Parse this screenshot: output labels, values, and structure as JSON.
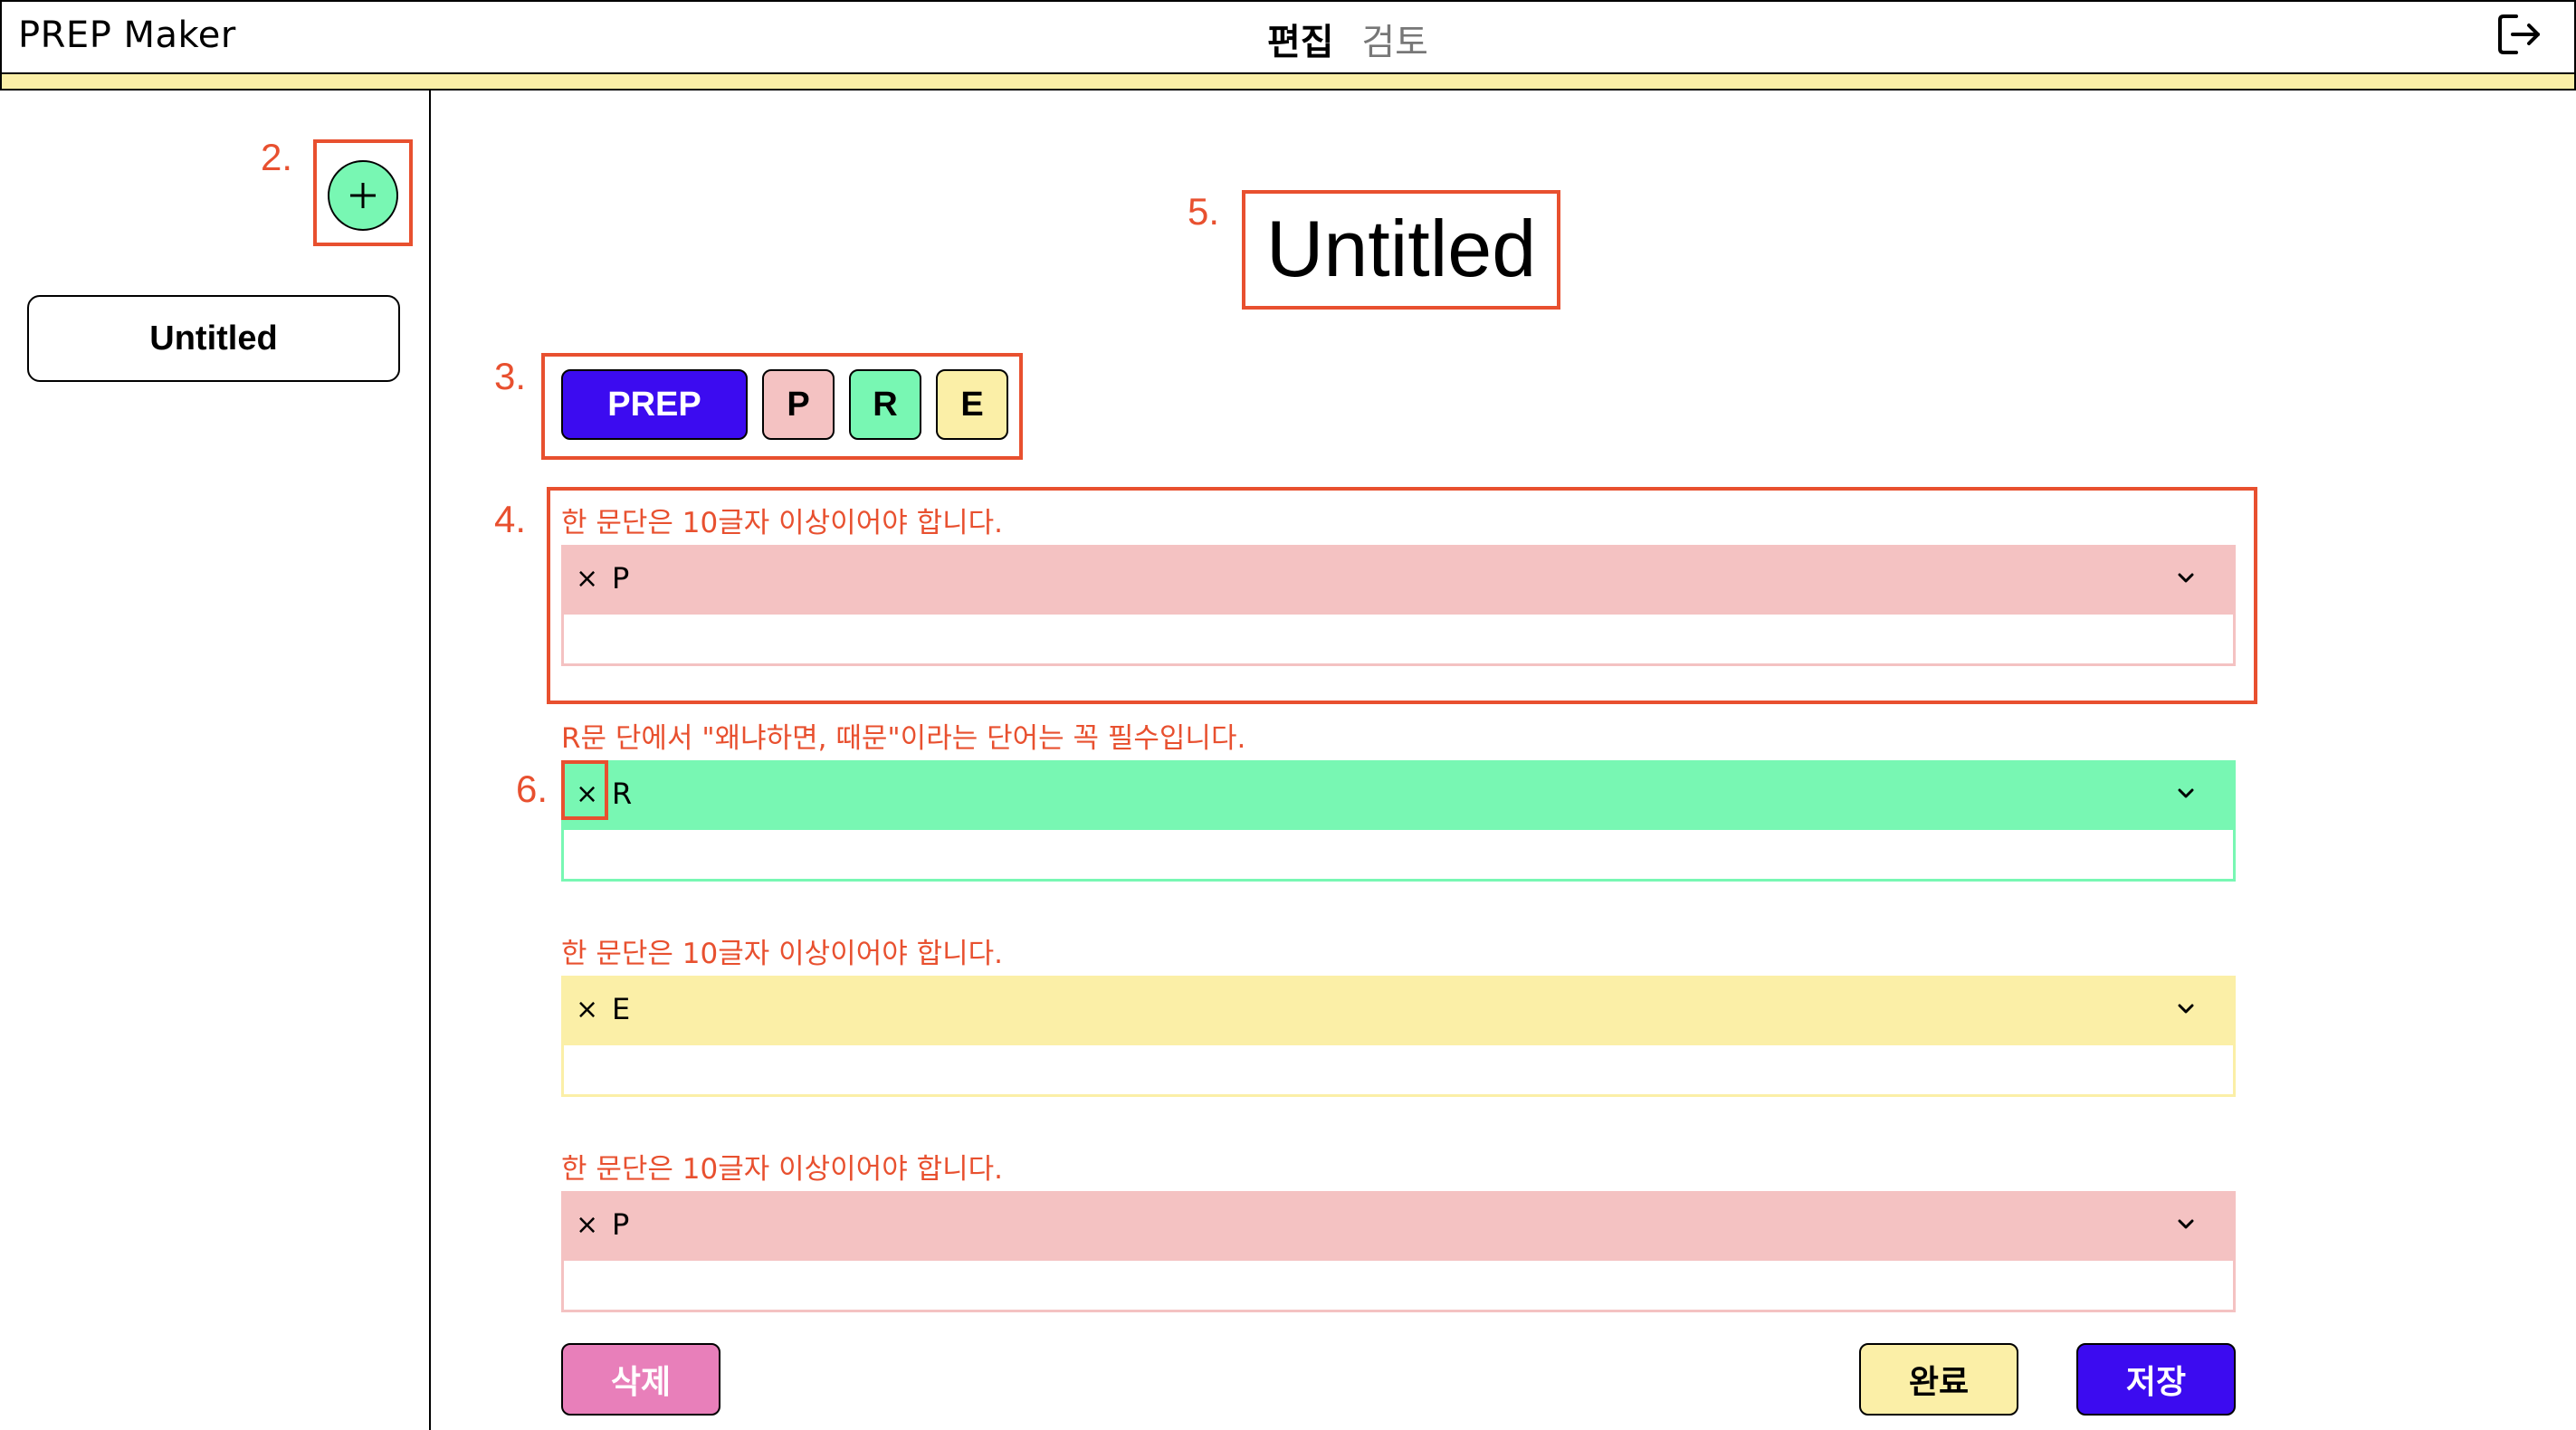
{
  "app": {
    "title": "PREP Maker"
  },
  "header": {
    "tabs": [
      {
        "label": "편집",
        "active": true
      },
      {
        "label": "검토",
        "active": false
      }
    ],
    "logout_icon": "logout-icon"
  },
  "sidebar": {
    "add_icon": "plus-icon",
    "documents": [
      {
        "title": "Untitled"
      }
    ]
  },
  "annotations": {
    "n2": "2.",
    "n3": "3.",
    "n4": "4.",
    "n5": "5.",
    "n6": "6."
  },
  "editor": {
    "title": "Untitled",
    "filters": {
      "prep": "PREP",
      "p": "P",
      "r": "R",
      "e": "E"
    },
    "paragraphs": [
      {
        "warning": "한 문단은 10글자 이상이어야 합니다.",
        "remove": "×",
        "type": "P",
        "value": "",
        "color": "#f4c2c2"
      },
      {
        "warning": "R문 단에서 \"왜냐하면, 때문\"이라는 단어는 꼭 필수입니다.",
        "remove": "×",
        "type": "R",
        "value": "",
        "color": "#78f7b3"
      },
      {
        "warning": "한 문단은 10글자 이상이어야 합니다.",
        "remove": "×",
        "type": "E",
        "value": "",
        "color": "#fbefa7"
      },
      {
        "warning": "한 문단은 10글자 이상이어야 합니다.",
        "remove": "×",
        "type": "P",
        "value": "",
        "color": "#f4c2c2"
      }
    ],
    "actions": {
      "delete": "삭제",
      "done": "완료",
      "save": "저장"
    }
  },
  "colors": {
    "accent_blue": "#3c0bf0",
    "pink": "#f4c2c2",
    "green": "#78f7b3",
    "yellow": "#fbefa7",
    "delete_pink": "#e87fba",
    "annotation": "#e8502f"
  }
}
